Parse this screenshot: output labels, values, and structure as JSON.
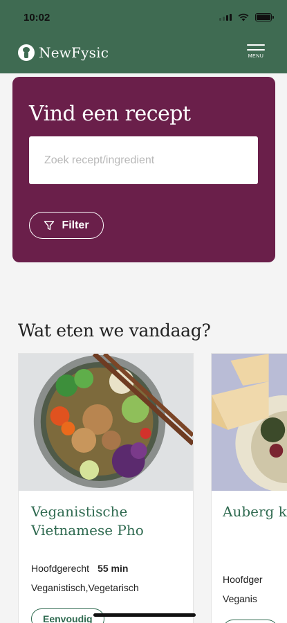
{
  "status": {
    "time": "10:02"
  },
  "header": {
    "brand": "NewFysic",
    "menu_label": "MENU"
  },
  "search": {
    "title": "Vind een recept",
    "placeholder": "Zoek recept/ingredient",
    "filter_label": "Filter"
  },
  "section": {
    "title": "Wat eten we vandaag?"
  },
  "recipes": [
    {
      "title": "Veganistische Vietnamese Pho",
      "category": "Hoofdgerecht",
      "time": "55 min",
      "tags": "Veganistisch,Vegetarisch",
      "difficulty": "Eenvoudig"
    },
    {
      "title": "Auberg knolbo pita",
      "category": "Hoofdger",
      "tags": "Veganis"
    }
  ],
  "colors": {
    "header": "#3f6b52",
    "search_card": "#6a1f4a",
    "accent_green": "#2f6a50"
  }
}
